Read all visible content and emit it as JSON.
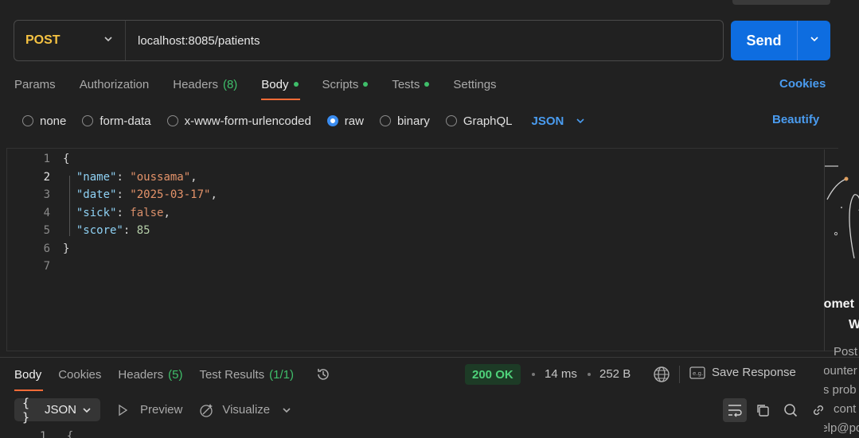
{
  "request": {
    "method": "POST",
    "url": "localhost:8085/patients",
    "send_label": "Send"
  },
  "request_tabs": [
    {
      "label": "Params"
    },
    {
      "label": "Authorization"
    },
    {
      "label": "Headers",
      "count": "(8)"
    },
    {
      "label": "Body",
      "dot": true,
      "active": true
    },
    {
      "label": "Scripts",
      "dot": true
    },
    {
      "label": "Tests",
      "dot": true
    },
    {
      "label": "Settings"
    }
  ],
  "cookies_label": "Cookies",
  "body_types": [
    {
      "label": "none",
      "selected": false
    },
    {
      "label": "form-data",
      "selected": false
    },
    {
      "label": "x-www-form-urlencoded",
      "selected": false
    },
    {
      "label": "raw",
      "selected": true
    },
    {
      "label": "binary",
      "selected": false
    },
    {
      "label": "GraphQL",
      "selected": false
    }
  ],
  "format": "JSON",
  "beautify_label": "Beautify",
  "editor": {
    "line_numbers": [
      "1",
      "2",
      "3",
      "4",
      "5",
      "6",
      "7"
    ],
    "open_brace": "{",
    "close_brace": "}",
    "fields": [
      {
        "key": "\"name\"",
        "value": "\"oussama\"",
        "type": "string",
        "comma": ","
      },
      {
        "key": "\"date\"",
        "value": "\"2025-03-17\"",
        "type": "string",
        "comma": ","
      },
      {
        "key": "\"sick\"",
        "value": "false",
        "type": "boolean",
        "comma": ","
      },
      {
        "key": "\"score\"",
        "value": "85",
        "type": "number",
        "comma": ""
      }
    ]
  },
  "side_panel": {
    "texts": [
      "Somet",
      "W",
      "Post",
      "encounter",
      "this prob",
      "cont",
      "help@po"
    ]
  },
  "response": {
    "tabs": [
      {
        "label": "Body",
        "active": true
      },
      {
        "label": "Cookies"
      },
      {
        "label": "Headers",
        "count": "(5)"
      },
      {
        "label": "Test Results",
        "count": "(1/1)"
      }
    ],
    "status": "200 OK",
    "time": "14 ms",
    "size": "252 B",
    "save_label": "Save Response",
    "format": "JSON",
    "preview_label": "Preview",
    "visualize_label": "Visualize",
    "first_line_number": "1",
    "first_line_code": "{"
  },
  "colors": {
    "accent": "#ff6c37",
    "send": "#0e6de0",
    "link": "#4a9cf0",
    "success": "#4fd27a",
    "method": "#f5c242"
  }
}
